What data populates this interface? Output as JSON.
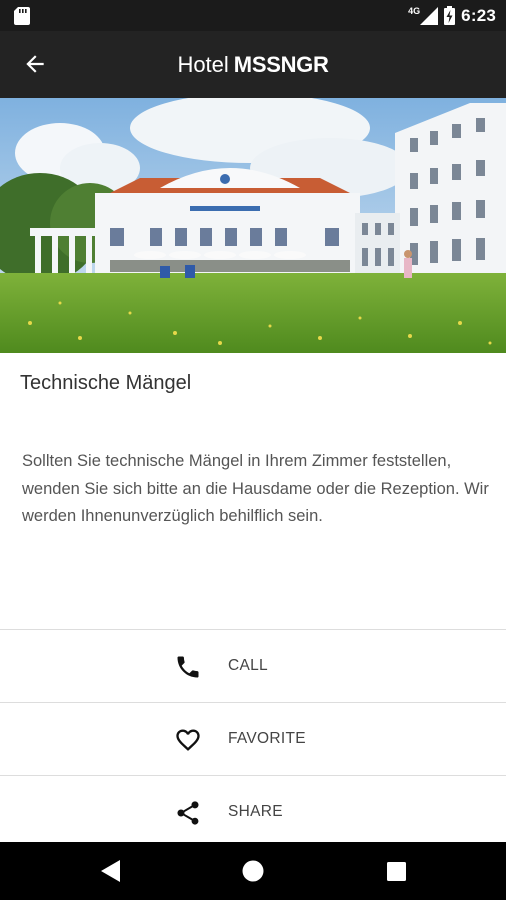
{
  "status_bar": {
    "network": "4G",
    "battery_icon": "battery-charging-icon",
    "time": "6:23"
  },
  "app_bar": {
    "title_prefix": "Hotel",
    "title_brand": "MSSNGR",
    "back_icon": "arrow-back-icon"
  },
  "content": {
    "heading": "Technische Mängel",
    "description": "Sollten Sie technische Mängel in Ihrem Zimmer feststellen, wenden Sie sich bitte an die Hausdame oder die Rezeption. Wir werden Ihnenunverzüglich behilflich sein."
  },
  "actions": [
    {
      "label": "CALL",
      "icon": "phone-icon"
    },
    {
      "label": "FAVORITE",
      "icon": "heart-icon"
    },
    {
      "label": "SHARE",
      "icon": "share-icon"
    }
  ],
  "nav_bar": {
    "back": "back-triangle-icon",
    "home": "home-circle-icon",
    "recents": "recents-square-icon"
  }
}
